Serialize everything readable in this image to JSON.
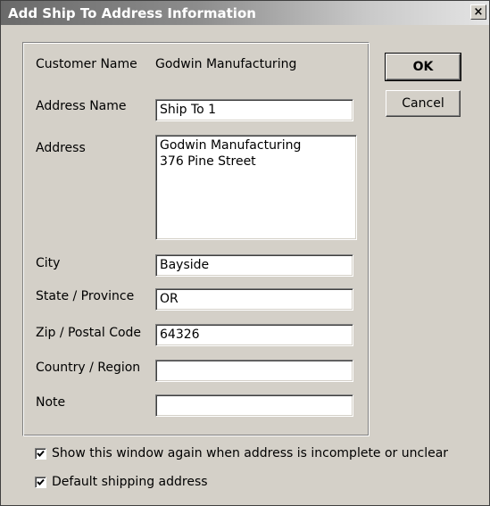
{
  "window": {
    "title": "Add Ship To Address Information",
    "close_glyph": "×"
  },
  "form": {
    "customer_name_label": "Customer Name",
    "customer_name_value": "Godwin Manufacturing",
    "address_name_label": "Address Name",
    "address_name_value": "Ship To 1",
    "address_label": "Address",
    "address_value": "Godwin Manufacturing\n376 Pine Street",
    "city_label": "City",
    "city_value": "Bayside",
    "state_label": "State / Province",
    "state_value": "OR",
    "zip_label": "Zip / Postal Code",
    "zip_value": "64326",
    "country_label": "Country / Region",
    "country_value": "",
    "note_label": "Note",
    "note_value": ""
  },
  "buttons": {
    "ok_label": "OK",
    "cancel_label": "Cancel"
  },
  "options": {
    "show_again_label": "Show this window again when address is incomplete or unclear",
    "show_again_checked": true,
    "default_shipping_label": "Default shipping address",
    "default_shipping_checked": true
  },
  "icons": {
    "close": "close-icon",
    "check": "checkmark-icon"
  }
}
